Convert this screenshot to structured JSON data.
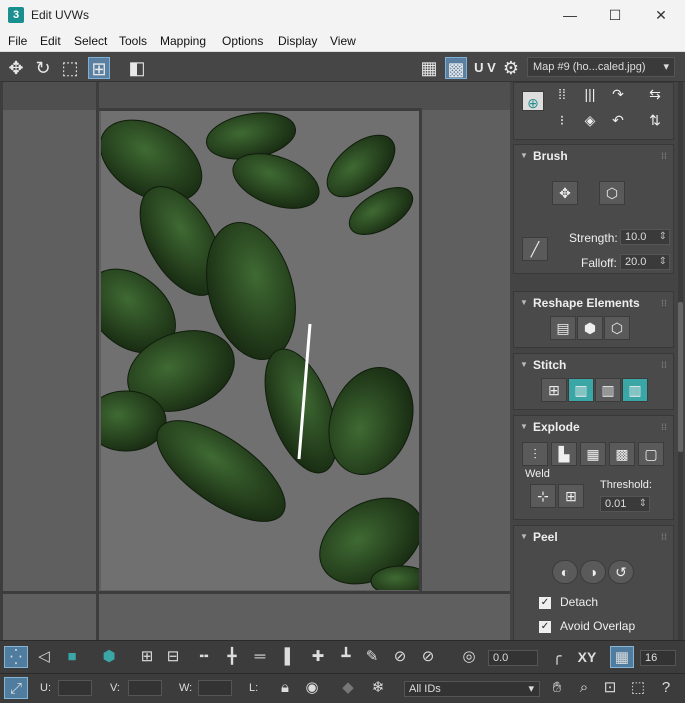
{
  "window": {
    "title": "Edit UVWs",
    "logo": "3",
    "minimize": "—",
    "maximize": "☐",
    "close": "✕"
  },
  "menu": [
    "File",
    "Edit",
    "Select",
    "Tools",
    "Mapping",
    "Options",
    "Display",
    "View"
  ],
  "toolbar": {
    "uv_label": "U V",
    "map_select": "Map #9 (ho...caled.jpg)"
  },
  "brush": {
    "title": "Brush",
    "strength_label": "Strength:",
    "strength_value": "10.0",
    "falloff_label": "Falloff:",
    "falloff_value": "20.0"
  },
  "reshape": {
    "title": "Reshape Elements"
  },
  "stitch": {
    "title": "Stitch"
  },
  "explode": {
    "title": "Explode",
    "weld_label": "Weld",
    "threshold_label": "Threshold:",
    "threshold_value": "0.01"
  },
  "peel": {
    "title": "Peel",
    "detach_label": "Detach",
    "avoid_overlap_label": "Avoid Overlap",
    "detach_checked": true,
    "avoid_overlap_checked": true
  },
  "bottom": {
    "angle_value": "0.0",
    "xy_label": "XY",
    "grid_value": "16",
    "u_label": "U:",
    "v_label": "V:",
    "w_label": "W:",
    "l_label": "L:",
    "ids_select": "All IDs"
  }
}
